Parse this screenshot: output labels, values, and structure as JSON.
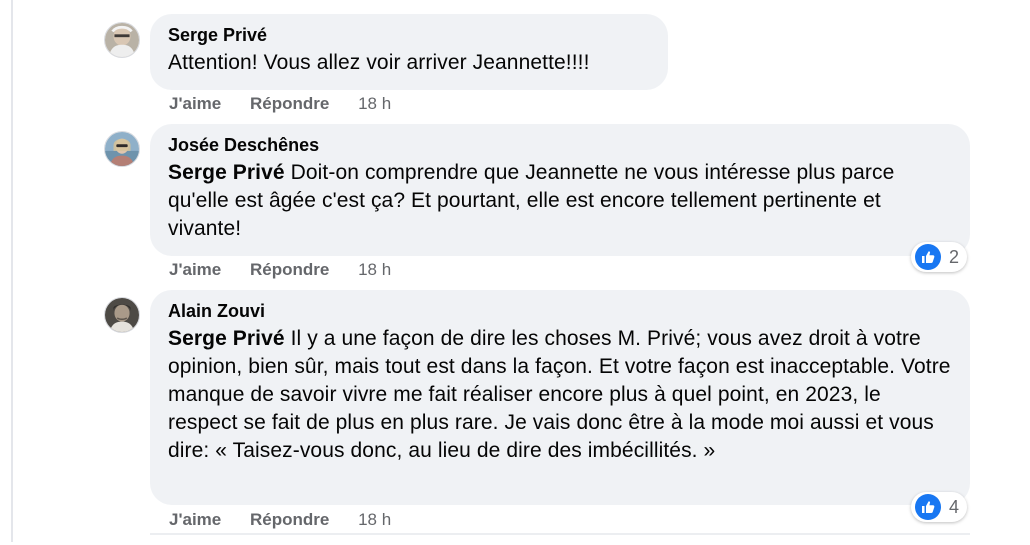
{
  "comments": [
    {
      "author": "Serge Privé",
      "mention": "",
      "text": "Attention! Vous allez voir arriver Jeannette!!!!",
      "actions": {
        "like": "J'aime",
        "reply": "Répondre",
        "time": "18 h"
      },
      "reactions": null
    },
    {
      "author": "Josée Deschênes",
      "mention": "Serge Privé",
      "text": "Doit-on comprendre que Jeannette ne vous intéresse plus parce qu'elle est âgée c'est ça? Et pourtant, elle est encore tellement pertinente et vivante!",
      "actions": {
        "like": "J'aime",
        "reply": "Répondre",
        "time": "18 h"
      },
      "reactions": {
        "icon": "like-icon",
        "count": "2"
      }
    },
    {
      "author": "Alain Zouvi",
      "mention": "Serge Privé",
      "text": "Il y a une façon de dire les choses M. Privé; vous avez droit à votre opinion, bien sûr, mais tout est dans la façon. Et votre façon est inacceptable. Votre manque de savoir vivre me fait réaliser encore plus à quel point, en 2023, le respect se fait de plus en plus rare. Je vais donc être à la mode moi aussi et vous dire: « Taisez-vous donc, au lieu de dire des imbécillités. »",
      "actions": {
        "like": "J'aime",
        "reply": "Répondre",
        "time": "18 h"
      },
      "reactions": {
        "icon": "like-icon",
        "count": "4"
      }
    }
  ],
  "colors": {
    "bubble": "#f0f2f5",
    "secondary_text": "#65676b",
    "like_blue": "#1877f2"
  }
}
